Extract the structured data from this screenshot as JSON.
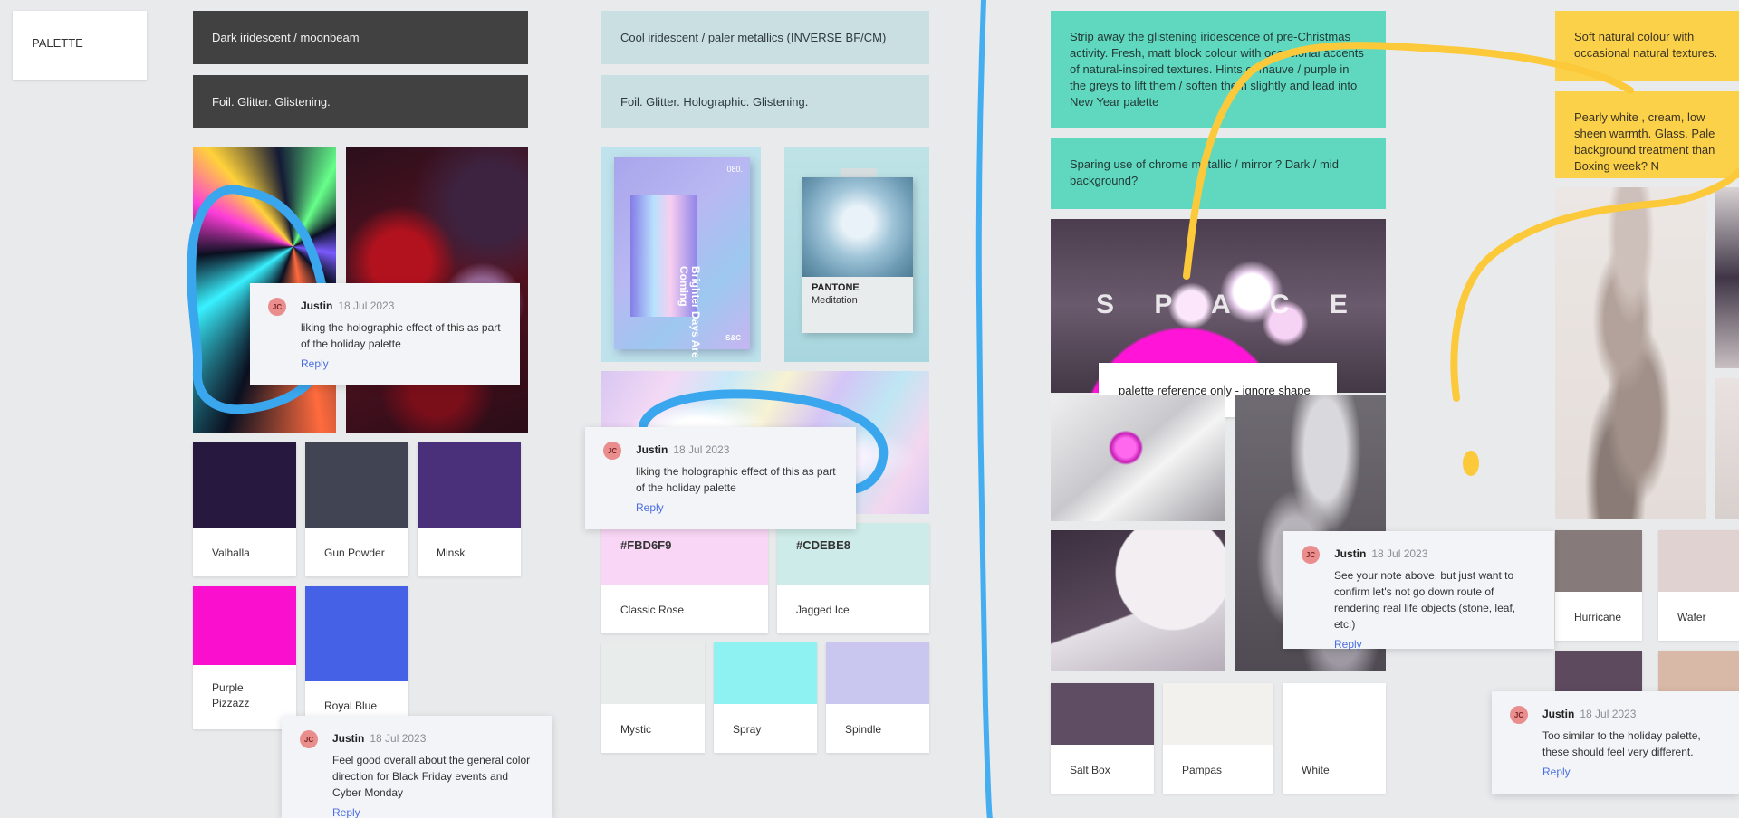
{
  "frame": {
    "palette_label": "PALETTE"
  },
  "colors": {
    "divider_blue": "#45aef0",
    "marker_blue": "#3aa6ee",
    "marker_yellow": "#fcc93a"
  },
  "column1": {
    "note1": "Dark iridescent / moonbeam",
    "note2": "Foil. Glitter. Glistening.",
    "swatches": [
      {
        "name": "Valhalla",
        "color": "#27183f"
      },
      {
        "name": "Gun Powder",
        "color": "#414453"
      },
      {
        "name": "Minsk",
        "color": "#4a2f7b"
      },
      {
        "name": "Purple Pizzazz",
        "color": "#fb0fce"
      },
      {
        "name": "Royal Blue",
        "color": "#4561e6"
      }
    ],
    "comment_photo": {
      "initials": "JC",
      "author": "Justin",
      "date": "18 Jul 2023",
      "body": "liking the holographic effect of this as part of the holiday palette",
      "reply": "Reply"
    },
    "comment_bottom": {
      "initials": "JC",
      "author": "Justin",
      "date": "18 Jul 2023",
      "body": "Feel good overall about the general color direction for Black Friday events and Cyber Monday",
      "reply": "Reply"
    }
  },
  "column2": {
    "note1": "Cool iridescent / paler metallics (INVERSE BF/CM)",
    "note2": "Foil. Glitter. Holographic. Glistening.",
    "poster_text": "Brighter Days Are Coming",
    "poster_small": "S&C",
    "poster_num": "080.",
    "pantone_title": "PANTONE",
    "pantone_sub": "Meditation",
    "hex_swatches": [
      {
        "hex": "#FBD6F9",
        "name": "Classic Rose",
        "color": "#f9d6f6"
      },
      {
        "hex": "#CDEBE8",
        "name": "Jagged Ice",
        "color": "#cdebe8"
      }
    ],
    "swatches": [
      {
        "name": "Mystic",
        "color": "#e8edec"
      },
      {
        "name": "Spray",
        "color": "#8ef1f2"
      },
      {
        "name": "Spindle",
        "color": "#c9c6f0"
      }
    ],
    "comment": {
      "initials": "JC",
      "author": "Justin",
      "date": "18 Jul 2023",
      "body": "liking the holographic effect of this as part of the holiday palette",
      "reply": "Reply"
    }
  },
  "column3": {
    "note1": "Strip away the glistening iridescence of pre-Christmas activity. Fresh, matt block colour with occasional accents of natural-inspired textures. Hints of mauve / purple in the greys to lift them / soften them slightly and lead into New Year palette",
    "note2": "Sparing use of chrome metallic / mirror ? Dark / mid background?",
    "space_text": "S P A C E",
    "label": "palette reference only - ignore shape",
    "swatches": [
      {
        "name": "Salt Box",
        "color": "#5f4d63"
      },
      {
        "name": "Pampas",
        "color": "#f3f1ee"
      },
      {
        "name": "White",
        "color": "#ffffff"
      }
    ],
    "comment": {
      "initials": "JC",
      "author": "Justin",
      "date": "18 Jul 2023",
      "body": "See your note above, but just want to confirm let's not go down route of rendering real life objects (stone, leaf, etc.)",
      "reply": "Reply"
    }
  },
  "column4": {
    "note1": "Soft natural colour with occasional natural textures.",
    "note2": "Pearly white , cream, low sheen warmth. Glass. Pale background treatment than Boxing week? N",
    "swatches": [
      {
        "name": "Hurricane",
        "color": "#877a7a"
      },
      {
        "name": "Wafer",
        "color": "#e0d2d0"
      },
      {
        "name": "",
        "color": "#5e4a5e"
      },
      {
        "name": "",
        "color": "#d8b8a6"
      }
    ],
    "comment": {
      "initials": "JC",
      "author": "Justin",
      "date": "18 Jul 2023",
      "body": "Too similar to the holiday palette, these should feel very different.",
      "reply": "Reply"
    }
  }
}
